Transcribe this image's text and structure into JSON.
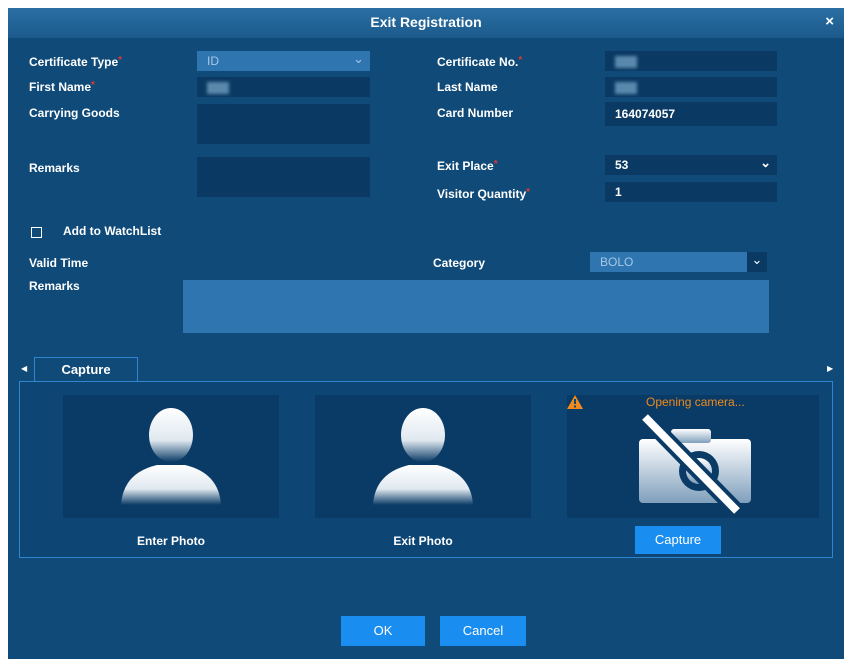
{
  "dialog": {
    "title": "Exit Registration",
    "close_label": "×"
  },
  "fields": {
    "certificate_type": {
      "label": "Certificate Type",
      "value": "ID"
    },
    "certificate_no": {
      "label": "Certificate No."
    },
    "first_name": {
      "label": "First Name"
    },
    "last_name": {
      "label": "Last Name"
    },
    "carrying_goods": {
      "label": "Carrying Goods"
    },
    "card_number": {
      "label": "Card Number",
      "value": "164074057"
    },
    "remarks": {
      "label": "Remarks"
    },
    "exit_place": {
      "label": "Exit Place",
      "value": "53"
    },
    "visitor_quantity": {
      "label": "Visitor Quantity",
      "value": "1"
    }
  },
  "required_mark": "*",
  "watchlist": {
    "checkbox_label": "Add to WatchList",
    "valid_time_label": "Valid Time",
    "category_label": "Category",
    "category_value": "BOLO",
    "remarks_label": "Remarks"
  },
  "capture": {
    "tab_label": "Capture",
    "enter_photo_label": "Enter Photo",
    "exit_photo_label": "Exit Photo",
    "warning_text": "Opening camera...",
    "capture_button_label": "Capture"
  },
  "footer": {
    "ok_label": "OK",
    "cancel_label": "Cancel"
  },
  "colors": {
    "background": "#0f4a78",
    "accent": "#1a8ef0",
    "required": "#e0392f",
    "warning": "#f08a1a"
  }
}
